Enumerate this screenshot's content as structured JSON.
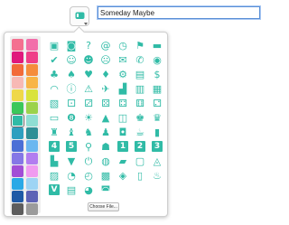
{
  "list": {
    "name_value": "Someday Maybe",
    "icon_name": "message-bubble-icon",
    "icon_color": "#30bba6"
  },
  "picker": {
    "accent_color": "#30bba6",
    "choose_file_label": "Choose File...",
    "selected_color": "#30bba6",
    "colors": [
      "#f47090",
      "#f26faa",
      "#e0187c",
      "#ef3e88",
      "#f26b3a",
      "#f58d3c",
      "#f7b9b5",
      "#f8b547",
      "#efd84a",
      "#d9e33c",
      "#3bc75a",
      "#9bd24b",
      "#30bba6",
      "#8fded3",
      "#2e9fbf",
      "#2f8f96",
      "#4b6fd6",
      "#6bb7f0",
      "#8577e6",
      "#b27df0",
      "#a24ed6",
      "#f09bf0",
      "#2aa9e6",
      "#9dd4f4",
      "#1f5aa6",
      "#5e63b6",
      "#5d5d5d",
      "#9b9b9b"
    ],
    "icons": [
      [
        "message-bubble-icon",
        "chat-bubbles-icon",
        "question-icon",
        "at-sign-icon",
        "clock-icon",
        "flag-icon",
        "speech-bubble-icon"
      ],
      [
        "checkmark-icon",
        "smile-icon",
        "neutral-face-icon",
        "sad-face-icon",
        "envelope-icon",
        "phone-icon",
        "rss-icon"
      ],
      [
        "clubs-icon",
        "spades-icon",
        "heart-icon",
        "diamond-icon",
        "gear-icon",
        "money-icon",
        "dollar-icon"
      ],
      [
        "wifi-icon",
        "info-icon",
        "warning-icon",
        "airplane-icon",
        "car-icon",
        "bus-icon",
        "train-icon"
      ],
      [
        "film-icon",
        "dice-one-icon",
        "dice-three-icon",
        "dice-five-icon",
        "dice-four-icon",
        "dice-six-icon",
        "dice-two-icon"
      ],
      [
        "game-controller-icon",
        "billiard-ball-icon",
        "lightbulb-icon",
        "bell-icon",
        "basket-icon",
        "chess-king-icon",
        "chess-queen-icon"
      ],
      [
        "chess-rook-icon",
        "chess-bishop-icon",
        "chess-knight-icon",
        "chess-pawn-icon",
        "shopping-bag-icon",
        "cup-icon",
        "bottle-icon"
      ],
      [
        "number-four-icon",
        "number-five-icon",
        "pin-icon",
        "person-icon",
        "number-one-icon",
        "number-two-icon",
        "number-three-icon"
      ],
      [
        "building-icon",
        "shopping-cart-icon",
        "power-icon",
        "globe-icon",
        "folder-icon",
        "tv-icon",
        "cake-icon"
      ],
      [
        "image-icon",
        "pacman-icon",
        "alarm-clock-icon",
        "briefcase-icon",
        "gift-icon",
        "clipboard-icon",
        "fire-icon"
      ],
      [
        "letter-v-icon",
        "document-icon",
        "clock-face-icon",
        "camera-icon",
        "",
        "",
        ""
      ]
    ]
  }
}
